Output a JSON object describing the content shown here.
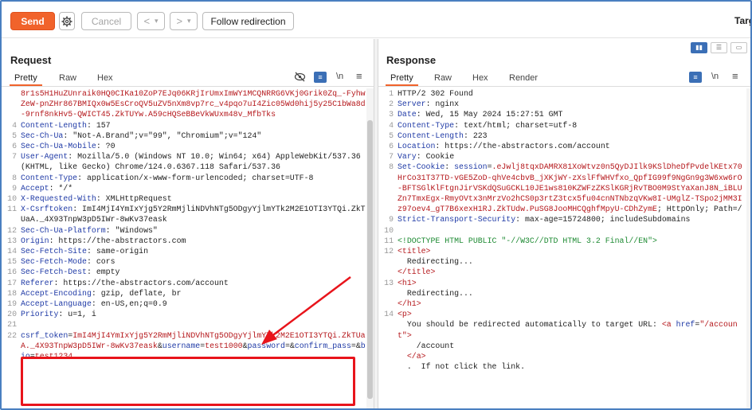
{
  "toolbar": {
    "send_label": "Send",
    "cancel_label": "Cancel",
    "back_label": "<",
    "back_dropdown": "▾",
    "forward_label": ">",
    "forward_dropdown": "▾",
    "follow_label": "Follow redirection",
    "target_label": "Targ",
    "gear_icon": "gear-icon"
  },
  "request": {
    "title": "Request",
    "tabs": [
      "Pretty",
      "Raw",
      "Hex"
    ],
    "icons": [
      "eye-slash-icon",
      "wrap-icon",
      "newline-icon",
      "menu-icon"
    ],
    "newline_label": "\\n",
    "lines": [
      {
        "n": "",
        "parts": [
          {
            "c": "red",
            "t": "8r1s5H1HuZUnraik0HQ0CIKa10ZoP7EJq06KRjIrUmxImWY1MCQNRRG6VKj0Grik0Zq_-FyhwZeW-pnZHr867BMIQx0w5EsCroQV5uZV5nXm8vp7rc_v4pqo7uI4Zic05Wd0hij5y25C1bWa8d-9rnf8nkHv5-QWICT45.ZkTUYw.A59cHQSeBBeVkWUxm48v_MfbTks"
          }
        ]
      },
      {
        "n": "4",
        "parts": [
          {
            "c": "hn",
            "t": "Content-Length"
          },
          {
            "c": "",
            "t": ": 157"
          }
        ]
      },
      {
        "n": "5",
        "parts": [
          {
            "c": "hn",
            "t": "Sec-Ch-Ua"
          },
          {
            "c": "",
            "t": ": \"Not-A.Brand\";v=\"99\", \"Chromium\";v=\"124\""
          }
        ]
      },
      {
        "n": "6",
        "parts": [
          {
            "c": "hn",
            "t": "Sec-Ch-Ua-Mobile"
          },
          {
            "c": "",
            "t": ": ?0"
          }
        ]
      },
      {
        "n": "7",
        "parts": [
          {
            "c": "hn",
            "t": "User-Agent"
          },
          {
            "c": "",
            "t": ": Mozilla/5.0 (Windows NT 10.0; Win64; x64) AppleWebKit/537.36 (KHTML, like Gecko) Chrome/124.0.6367.118 Safari/537.36"
          }
        ]
      },
      {
        "n": "8",
        "parts": [
          {
            "c": "hn",
            "t": "Content-Type"
          },
          {
            "c": "",
            "t": ": application/x-www-form-urlencoded; charset=UTF-8"
          }
        ]
      },
      {
        "n": "9",
        "parts": [
          {
            "c": "hn",
            "t": "Accept"
          },
          {
            "c": "",
            "t": ": */*"
          }
        ]
      },
      {
        "n": "10",
        "parts": [
          {
            "c": "hn",
            "t": "X-Requested-With"
          },
          {
            "c": "",
            "t": ": XMLHttpRequest"
          }
        ]
      },
      {
        "n": "11",
        "parts": [
          {
            "c": "hn",
            "t": "X-Csrftoken"
          },
          {
            "c": "",
            "t": ": ImI4MjI4YmIxYjg5Y2RmMjliNDVhNTg5ODgyYjlmYTk2M2E1OTI3YTQi.ZkTUaA._4X93TnpW3pD5IWr-8wKv37eask"
          }
        ]
      },
      {
        "n": "12",
        "parts": [
          {
            "c": "hn",
            "t": "Sec-Ch-Ua-Platform"
          },
          {
            "c": "",
            "t": ": \"Windows\""
          }
        ]
      },
      {
        "n": "13",
        "parts": [
          {
            "c": "hn",
            "t": "Origin"
          },
          {
            "c": "",
            "t": ": https://the-abstractors.com"
          }
        ]
      },
      {
        "n": "14",
        "parts": [
          {
            "c": "hn",
            "t": "Sec-Fetch-Site"
          },
          {
            "c": "",
            "t": ": same-origin"
          }
        ]
      },
      {
        "n": "15",
        "parts": [
          {
            "c": "hn",
            "t": "Sec-Fetch-Mode"
          },
          {
            "c": "",
            "t": ": cors"
          }
        ]
      },
      {
        "n": "16",
        "parts": [
          {
            "c": "hn",
            "t": "Sec-Fetch-Dest"
          },
          {
            "c": "",
            "t": ": empty"
          }
        ]
      },
      {
        "n": "17",
        "parts": [
          {
            "c": "hn",
            "t": "Referer"
          },
          {
            "c": "",
            "t": ": https://the-abstractors.com/account"
          }
        ]
      },
      {
        "n": "18",
        "parts": [
          {
            "c": "hn",
            "t": "Accept-Encoding"
          },
          {
            "c": "",
            "t": ": gzip, deflate, br"
          }
        ]
      },
      {
        "n": "19",
        "parts": [
          {
            "c": "hn",
            "t": "Accept-Language"
          },
          {
            "c": "",
            "t": ": en-US,en;q=0.9"
          }
        ]
      },
      {
        "n": "20",
        "parts": [
          {
            "c": "hn",
            "t": "Priority"
          },
          {
            "c": "",
            "t": ": u=1, i"
          }
        ]
      },
      {
        "n": "21",
        "parts": [
          {
            "c": "",
            "t": ""
          }
        ]
      },
      {
        "n": "22",
        "parts": [
          {
            "c": "blue",
            "t": "csrf_token"
          },
          {
            "c": "",
            "t": "="
          },
          {
            "c": "red",
            "t": "ImI4MjI4YmIxYjg5Y2RmMjliNDVhNTg5ODgyYjlmYTk2M2E1OTI3YTQi.ZkTUaA._4X93TnpW3pD5IWr-8wKv37eask"
          },
          {
            "c": "",
            "t": "&"
          },
          {
            "c": "blue",
            "t": "username"
          },
          {
            "c": "",
            "t": "="
          },
          {
            "c": "red",
            "t": "test1000"
          },
          {
            "c": "",
            "t": "&"
          },
          {
            "c": "blue",
            "t": "password"
          },
          {
            "c": "",
            "t": "=&"
          },
          {
            "c": "blue",
            "t": "confirm_pass"
          },
          {
            "c": "",
            "t": "=&"
          },
          {
            "c": "blue",
            "t": "bio"
          },
          {
            "c": "",
            "t": "="
          },
          {
            "c": "red",
            "t": "test1234"
          }
        ]
      }
    ]
  },
  "response": {
    "title": "Response",
    "tabs": [
      "Pretty",
      "Raw",
      "Hex",
      "Render"
    ],
    "icons": [
      "wrap-icon",
      "newline-icon",
      "menu-icon"
    ],
    "newline_label": "\\n",
    "layout_icons": [
      "split-horizontal-icon",
      "split-vertical-icon",
      "single-pane-icon"
    ],
    "lines": [
      {
        "n": "1",
        "parts": [
          {
            "c": "",
            "t": "HTTP/2 302 Found"
          }
        ]
      },
      {
        "n": "2",
        "parts": [
          {
            "c": "hn",
            "t": "Server"
          },
          {
            "c": "",
            "t": ": nginx"
          }
        ]
      },
      {
        "n": "3",
        "parts": [
          {
            "c": "hn",
            "t": "Date"
          },
          {
            "c": "",
            "t": ": Wed, 15 May 2024 15:27:51 GMT"
          }
        ]
      },
      {
        "n": "4",
        "parts": [
          {
            "c": "hn",
            "t": "Content-Type"
          },
          {
            "c": "",
            "t": ": text/html; charset=utf-8"
          }
        ]
      },
      {
        "n": "5",
        "parts": [
          {
            "c": "hn",
            "t": "Content-Length"
          },
          {
            "c": "",
            "t": ": 223"
          }
        ]
      },
      {
        "n": "6",
        "parts": [
          {
            "c": "hn",
            "t": "Location"
          },
          {
            "c": "",
            "t": ": https://the-abstractors.com/account"
          }
        ]
      },
      {
        "n": "7",
        "parts": [
          {
            "c": "hn",
            "t": "Vary"
          },
          {
            "c": "",
            "t": ": Cookie"
          }
        ]
      },
      {
        "n": "8",
        "parts": [
          {
            "c": "hn",
            "t": "Set-Cookie"
          },
          {
            "c": "",
            "t": ": "
          },
          {
            "c": "blue",
            "t": "session"
          },
          {
            "c": "",
            "t": "="
          },
          {
            "c": "red",
            "t": ".eJwlj8tqxDAMRX81XoWtvz0n5QyDJIlk9KSlDheDfPvdelKEtx70HrCo31T37TD-vGE5ZoD-qhVe4cbvB_jXKjWY-zXslFfWHVfxo_QpfIG99f9NgGn9g3W6xw6rO-BFTSGlKlFtgnJirVSKdQSuGCKL10JE1ws810KZWFzZKSlKGRjRvTBO0M9StYaXanJ8N_iBLUZn7TmxEgx-RmyOVtx3nMrzVo2hCS0p3rtZ3tcx5fu04cnNTNbzqVKw8I-UMglZ-TSpo2jMM3Iz97oev4_gT7B6xexH1RJ.ZkTUdw.PuSG8JooMHCQghfMpyU-CDhZymE"
          },
          {
            "c": "",
            "t": "; HttpOnly; Path=/"
          }
        ]
      },
      {
        "n": "9",
        "parts": [
          {
            "c": "hn",
            "t": "Strict-Transport-Security"
          },
          {
            "c": "",
            "t": ": max-age=15724800; includeSubdomains"
          }
        ]
      },
      {
        "n": "10",
        "parts": [
          {
            "c": "",
            "t": ""
          }
        ]
      },
      {
        "n": "11",
        "parts": [
          {
            "c": "green",
            "t": "<!DOCTYPE HTML PUBLIC \"-//W3C//DTD HTML 3.2 Final//EN\">"
          }
        ]
      },
      {
        "n": "12",
        "parts": [
          {
            "c": "red",
            "t": "<title>"
          }
        ]
      },
      {
        "n": "",
        "parts": [
          {
            "c": "",
            "t": "  Redirecting..."
          }
        ]
      },
      {
        "n": "",
        "parts": [
          {
            "c": "red",
            "t": "</title>"
          }
        ]
      },
      {
        "n": "13",
        "parts": [
          {
            "c": "red",
            "t": "<h1>"
          }
        ]
      },
      {
        "n": "",
        "parts": [
          {
            "c": "",
            "t": "  Redirecting..."
          }
        ]
      },
      {
        "n": "",
        "parts": [
          {
            "c": "red",
            "t": "</h1>"
          }
        ]
      },
      {
        "n": "14",
        "parts": [
          {
            "c": "red",
            "t": "<p>"
          }
        ]
      },
      {
        "n": "",
        "parts": [
          {
            "c": "",
            "t": "  You should be redirected automatically to target URL: "
          },
          {
            "c": "red",
            "t": "<a "
          },
          {
            "c": "blue",
            "t": "href"
          },
          {
            "c": "",
            "t": "="
          },
          {
            "c": "red",
            "t": "\"/account\""
          },
          {
            "c": "red",
            "t": ">"
          }
        ]
      },
      {
        "n": "",
        "parts": [
          {
            "c": "",
            "t": "    /account"
          }
        ]
      },
      {
        "n": "",
        "parts": [
          {
            "c": "",
            "t": "  "
          },
          {
            "c": "red",
            "t": "</a>"
          }
        ]
      },
      {
        "n": "",
        "parts": [
          {
            "c": "",
            "t": "  .  If not click the link."
          }
        ]
      }
    ]
  }
}
